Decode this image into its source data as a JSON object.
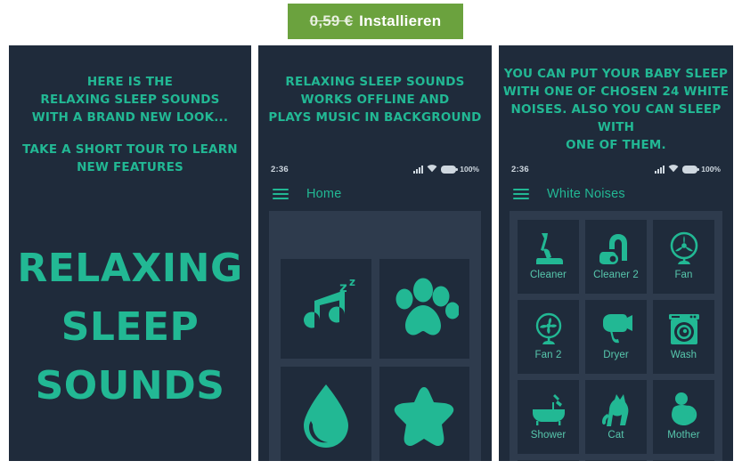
{
  "install": {
    "price": "0,59 €",
    "label": "Installieren",
    "button_color": "#6ba23e",
    "price_strikethrough": true
  },
  "theme": {
    "panel_background": "#1f2b3b",
    "sheet_background": "#2e3b4d",
    "accent_teal": "#22b894",
    "caption_teal": "#57c7ad",
    "page_background": "#ffffff"
  },
  "panels": [
    {
      "id": "panel-1",
      "promo_lines_a": [
        "HERE IS THE",
        "RELAXING SLEEP SOUNDS",
        "WITH A BRAND NEW LOOK..."
      ],
      "promo_lines_b": [
        "TAKE A SHORT TOUR TO LEARN",
        "NEW FEATURES"
      ],
      "hero_title_lines": [
        "RELAXING",
        "SLEEP",
        "SOUNDS"
      ]
    },
    {
      "id": "panel-2",
      "promo_lines_a": [
        "RELAXING SLEEP SOUNDS",
        "WORKS OFFLINE AND",
        "PLAYS MUSIC IN BACKGROUND"
      ],
      "statusbar": {
        "time": "2:36",
        "battery": "100%"
      },
      "appbar_title": "Home",
      "tiles": [
        {
          "name": "sleep-music",
          "icon": "music-note-zz-icon"
        },
        {
          "name": "animals",
          "icon": "paw-print-icon"
        },
        {
          "name": "water",
          "icon": "water-drop-icon"
        },
        {
          "name": "favorites",
          "icon": "star-icon"
        }
      ]
    },
    {
      "id": "panel-3",
      "promo_lines_a": [
        "YOU CAN PUT YOUR BABY SLEEP",
        "WITH ONE OF CHOSEN 24 WHITE",
        "NOISES. ALSO YOU CAN SLEEP WITH",
        "ONE OF THEM."
      ],
      "statusbar": {
        "time": "2:36",
        "battery": "100%"
      },
      "appbar_title": "White Noises",
      "noises": [
        {
          "label": "Cleaner",
          "icon": "upright-vacuum-icon"
        },
        {
          "label": "Cleaner 2",
          "icon": "canister-vacuum-icon"
        },
        {
          "label": "Fan",
          "icon": "ceiling-fan-icon"
        },
        {
          "label": "Fan 2",
          "icon": "table-fan-icon"
        },
        {
          "label": "Dryer",
          "icon": "hair-dryer-icon"
        },
        {
          "label": "Wash",
          "icon": "washing-machine-icon"
        },
        {
          "label": "Shower",
          "icon": "bathtub-icon"
        },
        {
          "label": "Cat",
          "icon": "cat-icon"
        },
        {
          "label": "Mother",
          "icon": "mother-baby-icon"
        }
      ]
    }
  ]
}
